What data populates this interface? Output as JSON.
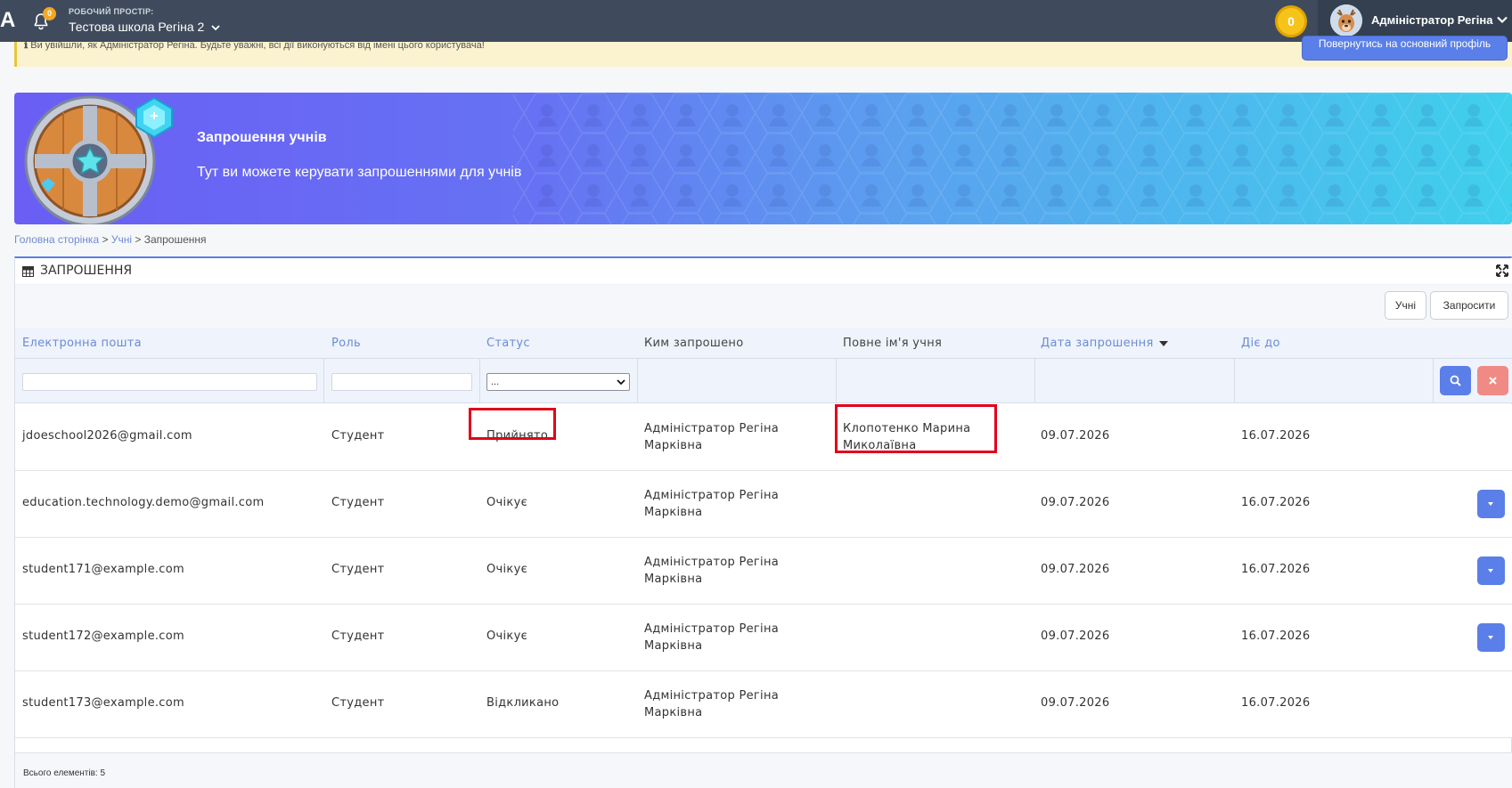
{
  "topbar": {
    "logo_letter": "A",
    "notifications_count": "0",
    "workspace_label": "РОБОЧИЙ ПРОСТІР:",
    "workspace_name": "Тестова школа Регіна 2",
    "coins": "0",
    "user_name": "Адміністратор Регіна"
  },
  "warning": {
    "text": "Ви увійшли, як Адміністратор Регіна. Будьте уважні, всі дії виконуються від імені цього користувача!",
    "return_button": "Повернутись на основний профіль"
  },
  "banner": {
    "title": "Запрошення учнів",
    "subtitle": "Тут ви можете керувати запрошеннями для учнів"
  },
  "breadcrumb": {
    "home": "Головна сторінка",
    "separator": ">",
    "students": "Учні",
    "current": "Запрошення"
  },
  "panel": {
    "title": "ЗАПРОШЕННЯ",
    "students_button": "Учні",
    "invite_button": "Запросити"
  },
  "table": {
    "columns": {
      "email": "Електронна пошта",
      "role": "Роль",
      "status": "Статус",
      "invited_by": "Ким запрошено",
      "student_name": "Повне ім'я учня",
      "invite_date": "Дата запрошення",
      "valid_until": "Діє до"
    },
    "status_filter_value": "...",
    "rows": [
      {
        "email": "jdoeschool2026@gmail.com",
        "role": "Студент",
        "status": "Прийнято",
        "invited_by_1": "Адміністратор Регіна",
        "invited_by_2": "Марківна",
        "name_1": "Клопотенко Марина",
        "name_2": "Миколаївна",
        "date": "09.07.2026",
        "until": "16.07.2026"
      },
      {
        "email": "education.technology.demo@gmail.com",
        "role": "Студент",
        "status": "Очікує",
        "invited_by_1": "Адміністратор Регіна",
        "invited_by_2": "Марківна",
        "name_1": "",
        "name_2": "",
        "date": "09.07.2026",
        "until": "16.07.2026"
      },
      {
        "email": "student171@example.com",
        "role": "Студент",
        "status": "Очікує",
        "invited_by_1": "Адміністратор Регіна",
        "invited_by_2": "Марківна",
        "name_1": "",
        "name_2": "",
        "date": "09.07.2026",
        "until": "16.07.2026"
      },
      {
        "email": "student172@example.com",
        "role": "Студент",
        "status": "Очікує",
        "invited_by_1": "Адміністратор Регіна",
        "invited_by_2": "Марківна",
        "name_1": "",
        "name_2": "",
        "date": "09.07.2026",
        "until": "16.07.2026"
      },
      {
        "email": "student173@example.com",
        "role": "Студент",
        "status": "Відкликано",
        "invited_by_1": "Адміністратор Регіна",
        "invited_by_2": "Марківна",
        "name_1": "",
        "name_2": "",
        "date": "09.07.2026",
        "until": "16.07.2026"
      }
    ],
    "total": "Всього елементів: 5"
  },
  "colors": {
    "accent": "#5b7fe8",
    "topbar": "#3f4b5c",
    "highlight": "#e0001b",
    "danger": "#f08a84"
  },
  "icons": [
    "bell-icon",
    "chevron-down-icon",
    "coin-icon",
    "avatar-deer-icon",
    "info-icon",
    "shield-icon",
    "gem-icon",
    "grid-icon",
    "expand-icon",
    "search-icon",
    "close-icon",
    "caret-down-icon"
  ]
}
